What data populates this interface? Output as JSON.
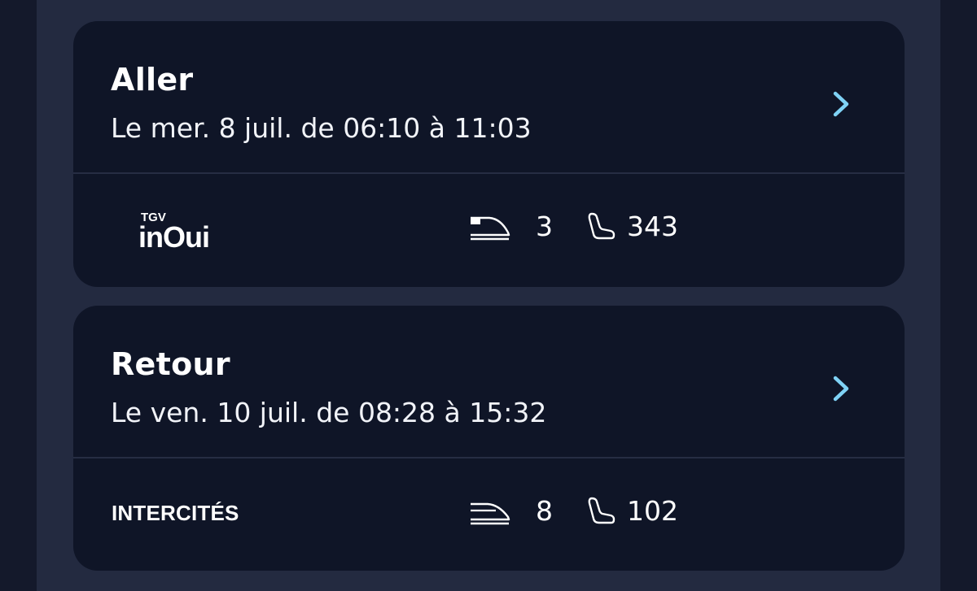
{
  "trips": [
    {
      "title": "Aller",
      "details": "Le mer. 8 juil. de 06:10 à 11:03",
      "brand_small": "TGV",
      "brand_main": "inOui",
      "train_icon": "tgv-train-icon",
      "train_number": "3",
      "seat_icon": "seat-icon",
      "seat_number": "343"
    },
    {
      "title": "Retour",
      "details": "Le ven. 10 juil. de 08:28 à 15:32",
      "brand_text": "INTERCITÉS",
      "train_icon": "intercites-train-icon",
      "train_number": "8",
      "seat_icon": "seat-icon",
      "seat_number": "102"
    }
  ],
  "colors": {
    "background": "#14192b",
    "panel": "#232a40",
    "card": "#0f1527",
    "divider": "#262d43",
    "accent": "#7fd2f5",
    "text": "#ffffff"
  }
}
